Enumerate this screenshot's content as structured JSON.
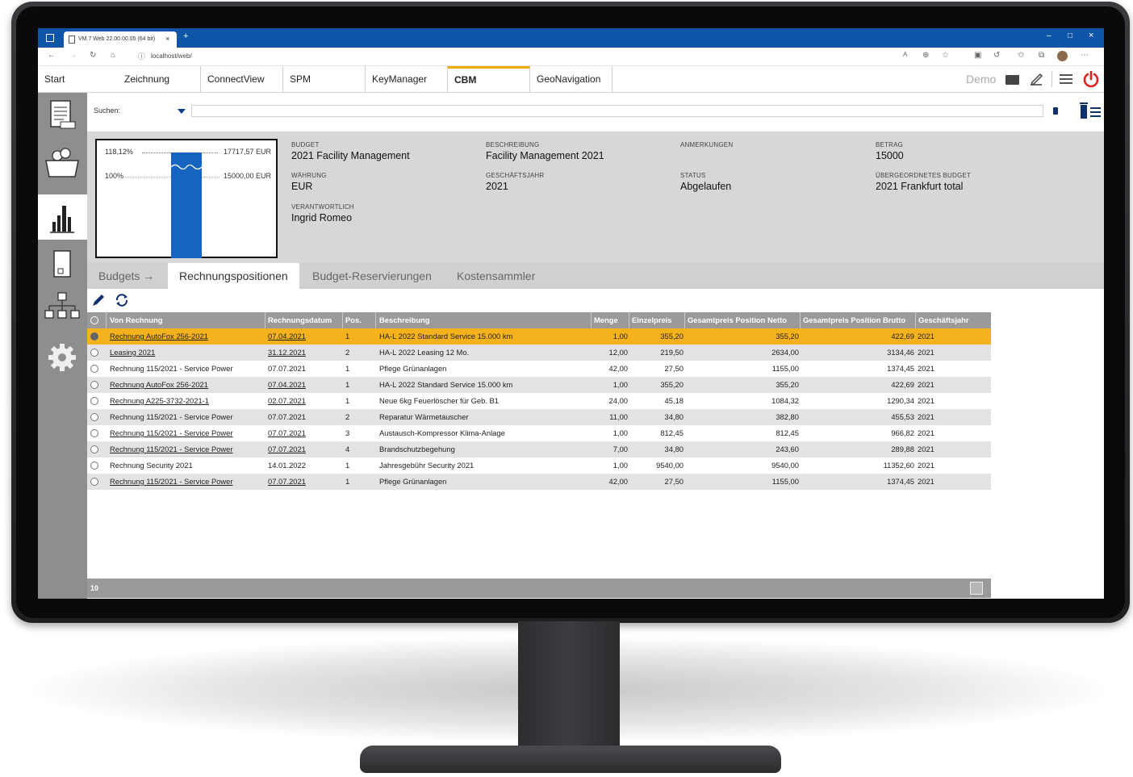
{
  "browser": {
    "tab_title": "VM.7 Web 22.00.00.05 (64 bit)",
    "address": "localhost/web/"
  },
  "app_tabs": [
    "Start",
    "Zeichnung",
    "ConnectView",
    "SPM",
    "KeyManager",
    "CBM",
    "GeoNavigation"
  ],
  "active_app_tab": "CBM",
  "header_right": {
    "user": "Demo"
  },
  "search": {
    "label": "Suchen:",
    "value": ""
  },
  "gauge": {
    "top_pct": "118,12%",
    "top_amount": "17717,57 EUR",
    "base_pct": "100%",
    "base_amount": "15000,00 EUR",
    "fill_ratio": 1.1812
  },
  "fields": {
    "budget_label": "BUDGET",
    "budget_value": "2021 Facility Management",
    "beschreibung_label": "BESCHREIBUNG",
    "beschreibung_value": "Facility Management 2021",
    "anmerkungen_label": "ANMERKUNGEN",
    "betrag_label": "BETRAG",
    "betrag_value": "15000",
    "waehrung_label": "WÄHRUNG",
    "waehrung_value": "EUR",
    "geschaeftsjahr_label": "GESCHÄFTSJAHR",
    "geschaeftsjahr_value": "2021",
    "status_label": "STATUS",
    "status_value": "Abgelaufen",
    "parent_label": "ÜBERGEORDNETES BUDGET",
    "parent_value": "2021 Frankfurt total",
    "verantwortlich_label": "VERANTWORTLICH",
    "verantwortlich_value": "Ingrid Romeo"
  },
  "sub_tabs": [
    "Budgets →",
    "Rechnungspositionen",
    "Budget-Reservierungen",
    "Kostensammler"
  ],
  "active_sub_tab": "Rechnungspositionen",
  "table": {
    "columns": [
      "Von Rechnung",
      "Rechnungsdatum",
      "Pos.",
      "Beschreibung",
      "Menge",
      "Einzelpreis",
      "Gesamtpreis Position Netto",
      "Gesamtpreis Position Brutto",
      "Geschäftsjahr"
    ],
    "rows": [
      {
        "rechnung": "Rechnung AutoFox 256-2021",
        "datum": "07.04.2021",
        "pos": "1",
        "beschreibung": "HA-L 2022 Standard Service 15.000 km",
        "menge": "1,00",
        "einzel": "355,20",
        "netto": "355,20",
        "brutto": "422,69",
        "jahr": "2021",
        "link": true,
        "selected": true
      },
      {
        "rechnung": "Leasing 2021",
        "datum": "31.12.2021",
        "pos": "2",
        "beschreibung": "HA-L 2022 Leasing 12 Mo.",
        "menge": "12,00",
        "einzel": "219,50",
        "netto": "2634,00",
        "brutto": "3134,46",
        "jahr": "2021",
        "link": true,
        "selected": false
      },
      {
        "rechnung": "Rechnung 115/2021 - Service Power",
        "datum": "07.07.2021",
        "pos": "1",
        "beschreibung": "Pflege Grünanlagen",
        "menge": "42,00",
        "einzel": "27,50",
        "netto": "1155,00",
        "brutto": "1374,45",
        "jahr": "2021",
        "link": false,
        "selected": false
      },
      {
        "rechnung": "Rechnung AutoFox 256-2021",
        "datum": "07.04.2021",
        "pos": "1",
        "beschreibung": "HA-L 2022 Standard Service 15.000 km",
        "menge": "1,00",
        "einzel": "355,20",
        "netto": "355,20",
        "brutto": "422,69",
        "jahr": "2021",
        "link": true,
        "selected": false
      },
      {
        "rechnung": "Rechnung A225-3732-2021-1",
        "datum": "02.07.2021",
        "pos": "1",
        "beschreibung": "Neue 6kg Feuerlöscher für Geb. B1",
        "menge": "24,00",
        "einzel": "45,18",
        "netto": "1084,32",
        "brutto": "1290,34",
        "jahr": "2021",
        "link": true,
        "selected": false
      },
      {
        "rechnung": "Rechnung 115/2021 - Service Power",
        "datum": "07.07.2021",
        "pos": "2",
        "beschreibung": "Reparatur Wärmetauscher",
        "menge": "11,00",
        "einzel": "34,80",
        "netto": "382,80",
        "brutto": "455,53",
        "jahr": "2021",
        "link": false,
        "selected": false
      },
      {
        "rechnung": "Rechnung 115/2021 - Service Power",
        "datum": "07.07.2021",
        "pos": "3",
        "beschreibung": "Austausch-Kompressor Klima-Anlage",
        "menge": "1,00",
        "einzel": "812,45",
        "netto": "812,45",
        "brutto": "966,82",
        "jahr": "2021",
        "link": true,
        "selected": false
      },
      {
        "rechnung": "Rechnung 115/2021 - Service Power",
        "datum": "07.07.2021",
        "pos": "4",
        "beschreibung": "Brandschutzbegehung",
        "menge": "7,00",
        "einzel": "34,80",
        "netto": "243,60",
        "brutto": "289,88",
        "jahr": "2021",
        "link": true,
        "selected": false
      },
      {
        "rechnung": "Rechnung Security 2021",
        "datum": "14.01.2022",
        "pos": "1",
        "beschreibung": "Jahresgebühr Security 2021",
        "menge": "1,00",
        "einzel": "9540,00",
        "netto": "9540,00",
        "brutto": "11352,60",
        "jahr": "2021",
        "link": false,
        "selected": false
      },
      {
        "rechnung": "Rechnung 115/2021 - Service Power",
        "datum": "07.07.2021",
        "pos": "1",
        "beschreibung": "Pflege Grünanlagen",
        "menge": "42,00",
        "einzel": "27,50",
        "netto": "1155,00",
        "brutto": "1374,45",
        "jahr": "2021",
        "link": true,
        "selected": false
      }
    ]
  },
  "footer": {
    "count": "10"
  },
  "colors": {
    "accent": "#f0a900",
    "selected_row": "#f5b21c",
    "brand_blue": "#0e55a8",
    "gauge_blue": "#1565c0",
    "power_red": "#e02020"
  }
}
